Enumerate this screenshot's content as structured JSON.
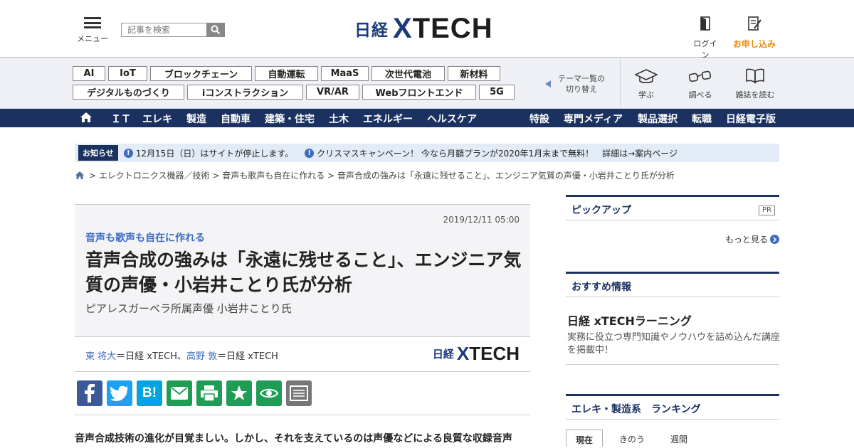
{
  "header": {
    "menu_label": "メニュー",
    "search_placeholder": "記事を検索",
    "logo_nikkei": "日経",
    "logo_x": "X",
    "logo_tech": "TECH",
    "login_label": "ログイン",
    "apply_label": "お申し込み"
  },
  "themes": {
    "tags": [
      "AI",
      "IoT",
      "ブロックチェーン",
      "自動運転",
      "MaaS",
      "次世代電池",
      "新材料",
      "デジタルものづくり",
      "iコンストラクション",
      "VR/AR",
      "Webフロントエンド",
      "5G"
    ],
    "switch_line1": "テーマ一覧の",
    "switch_line2": "切り替え",
    "tools": [
      "学ぶ",
      "調べる",
      "雑誌を読む"
    ]
  },
  "nav": {
    "left": [
      "ＩＴ",
      "エレキ",
      "製造",
      "自動車",
      "建築・住宅",
      "土木",
      "エネルギー",
      "ヘルスケア"
    ],
    "right": [
      "特設",
      "専門メディア",
      "製品選択",
      "転職",
      "日経電子版"
    ]
  },
  "notice": {
    "badge": "お知らせ",
    "item1": "12月15日（日）はサイトが停止します。",
    "item2": "クリスマスキャンペーン！ 今なら月額プランが2020年1月末まで無料！　詳細は→案内ページ"
  },
  "breadcrumb": [
    "エレクトロニクス機器／技術",
    "音声も歌声も自在に作れる",
    "音声合成の強みは「永遠に残せること」、エンジニア気質の声優・小岩井ことり氏が分析"
  ],
  "article": {
    "date": "2019/12/11 05:00",
    "series": "音声も歌声も自在に作れる",
    "title": "音声合成の強みは「永遠に残せること」、エンジニア気質の声優・小岩井ことり氏が分析",
    "subtitle": "ピアレスガーベラ所属声優 小岩井ことり氏",
    "author1": "東 将大",
    "author1_org": "＝日経 xTECH、",
    "author2": "高野 敦",
    "author2_org": "＝日経 xTECH",
    "lead": "音声合成技術の進化が目覚ましい。しかし、それを支えているのは声優などによる良質な収録音声"
  },
  "share": {
    "hatena": "B!"
  },
  "sidebar": {
    "pickup_title": "ピックアップ",
    "pr_label": "PR",
    "more_label": "もっと見る",
    "recommend_title": "おすすめ情報",
    "rec_item_title": "日経 xTECHラーニング",
    "rec_item_desc": "実務に役立つ専門知識やノウハウを詰め込んだ講座を掲載中！",
    "ranking_title": "エレキ・製造系　ランキング",
    "ranking_tabs": [
      "現在",
      "きのう",
      "週間"
    ]
  },
  "colors": {
    "navy": "#1b3260",
    "link_blue": "#3c6bc0",
    "accent_orange": "#e8890c",
    "facebook": "#3b5998",
    "twitter": "#1da1f2",
    "hatena": "#00a4de",
    "green": "#1f9d55",
    "gray_btn": "#777777"
  }
}
